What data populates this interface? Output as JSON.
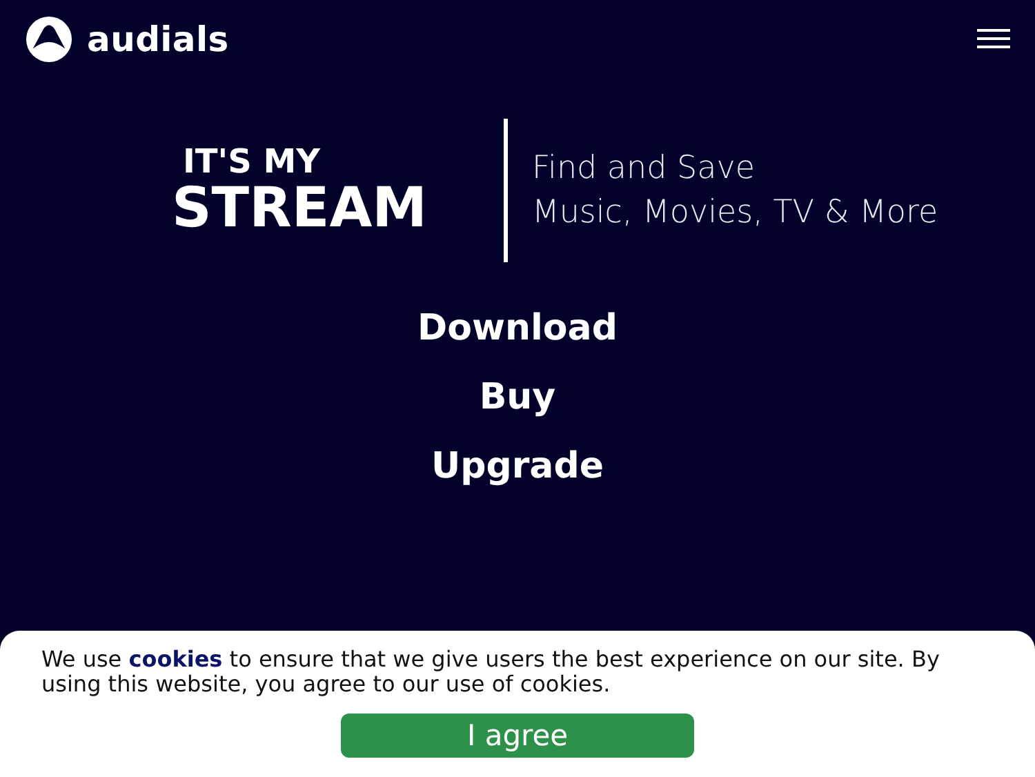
{
  "header": {
    "logo_text": "audials"
  },
  "hero": {
    "tagline_small": "IT'S MY",
    "tagline_big": "STREAM",
    "subtitle_lines": [
      "Find and Save",
      "Music, Movies, TV & More"
    ]
  },
  "links": [
    "Download",
    "Buy",
    "Upgrade"
  ],
  "cookie_banner": {
    "text_before": "We use",
    "link": "cookies",
    "text_after": "to ensure that we give users the best experience on our site. By using this website, you agree to our use of cookies.",
    "button": "I agree"
  }
}
